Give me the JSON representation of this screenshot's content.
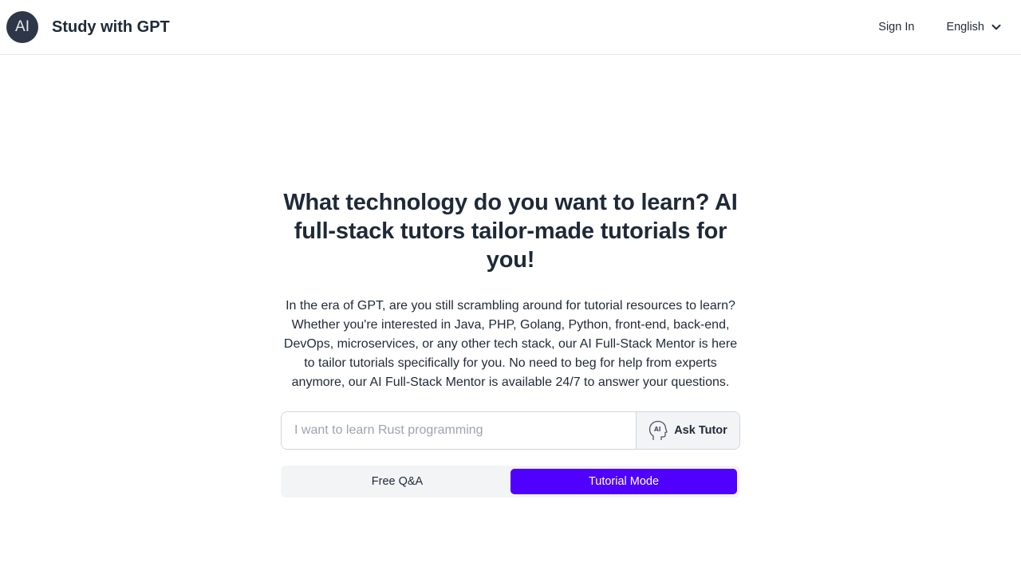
{
  "header": {
    "logo_text": "AI",
    "brand": "Study with GPT",
    "sign_in": "Sign In",
    "language": "English"
  },
  "hero": {
    "title": "What technology do you want to learn? AI full-stack tutors tailor-made tutorials for you!",
    "description": "In the era of GPT, are you still scrambling around for tutorial resources to learn? Whether you're interested in Java, PHP, Golang, Python, front-end, back-end, DevOps, microservices, or any other tech stack, our AI Full-Stack Mentor is here to tailor tutorials specifically for you. No need to beg for help from experts anymore, our AI Full-Stack Mentor is available 24/7 to answer your questions."
  },
  "search": {
    "value": "",
    "placeholder": "I want to learn Rust programming",
    "button_label": "Ask Tutor"
  },
  "modes": [
    {
      "label": "Free Q&A",
      "active": false
    },
    {
      "label": "Tutorial Mode",
      "active": true
    }
  ],
  "colors": {
    "accent": "#5000ff",
    "avatar_bg": "#2d3748"
  },
  "icons": {
    "chevron": "chevron-down-icon",
    "tutor": "ai-head-icon"
  }
}
